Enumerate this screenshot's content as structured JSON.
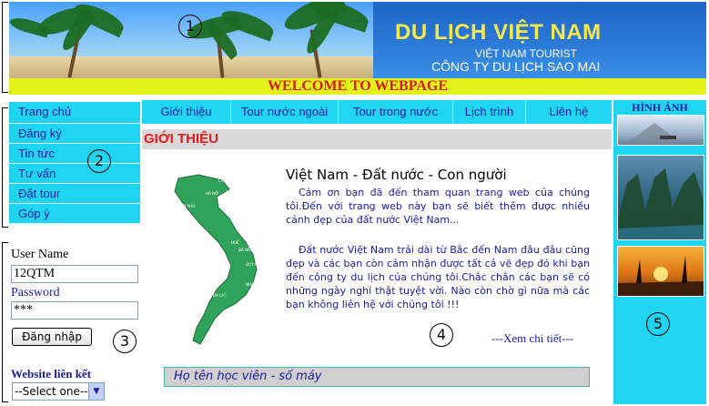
{
  "header": {
    "title": "DU LỊCH VIỆT NAM",
    "subtitle": "VIỆT NAM TOURIST",
    "company": "CÔNG TY DU LỊCH SAO MAI",
    "welcome": "WELCOME TO WEBPAGE"
  },
  "left_nav": {
    "items": [
      "Trang chủ",
      "Đăng ký",
      "Tin tức",
      "Tư vấn",
      "Đặt tour",
      "Góp ý"
    ]
  },
  "login": {
    "username_label": "User Name",
    "username_value": "12QTM",
    "password_label": "Password",
    "password_value": "***",
    "submit_label": "Đăng nhập"
  },
  "links": {
    "label": "Website liên kết",
    "select_value": "--Select one--"
  },
  "top_nav": {
    "tabs": [
      "Giới thiệu",
      "Tour nước ngoài",
      "Tour trong nước",
      "Lịch trình",
      "Liên hệ"
    ]
  },
  "content": {
    "section_title": "GIỚI THIỆU",
    "heading": "Việt Nam - Đất nước - Con người",
    "para1": "Cám ơn bạn đã đến tham quan trang web của chúng tôi.Đến với trang web này bạn sẽ biết thêm được nhiều cảnh đẹp của đất nước Việt Nam...",
    "para2": "Đất nước Việt Nam trải dài từ Bắc đến Nam đâu đâu cũng đẹp và các bạn còn cảm nhận được tất cả vẽ đẹp đó khi bạn đến công ty du lịch của chúng tôi.Chắc chắn các bạn sẽ có những ngày nghỉ thật tuyệt vời. Nào còn chờ gì nữa mà các bạn không liên hệ với chúng tôi !!!",
    "more_link": "---Xem chi tiết---",
    "student_bar": "Họ tên học viên - số máy"
  },
  "right_col": {
    "title": "HÌNH ẢNH"
  },
  "markers": [
    "1",
    "2",
    "3",
    "4",
    "5"
  ],
  "colors": {
    "nav_bg": "#1fd5f2",
    "nav_text": "#1a1aa6",
    "welcome_bg": "#e2f21a",
    "welcome_text": "#d81b1b",
    "title_yellow": "#f7e94a",
    "section_red": "#e5181b"
  }
}
